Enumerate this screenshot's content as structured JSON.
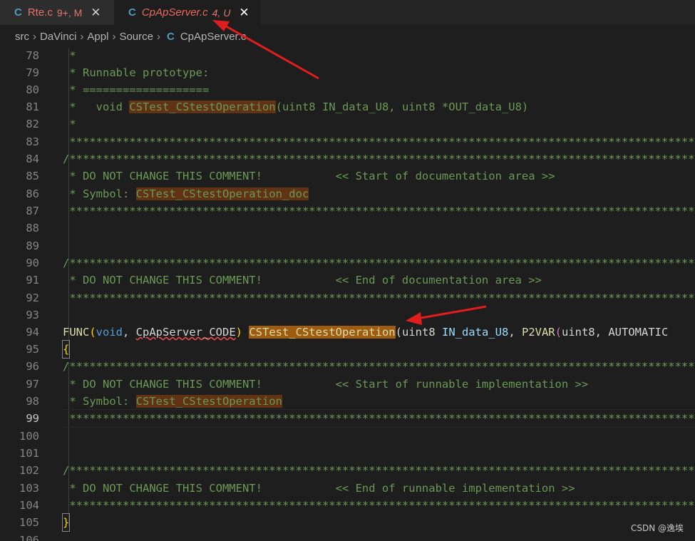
{
  "tabs": [
    {
      "icon": "C",
      "label": "Rte.c",
      "badge": "9+, M",
      "close": "✕"
    },
    {
      "icon": "C",
      "label": "CpApServer.c",
      "badge": "4, U",
      "close": "✕"
    }
  ],
  "breadcrumb": {
    "items": [
      "src",
      "DaVinci",
      "Appl",
      "Source"
    ],
    "file_icon": "C",
    "file": "CpApServer.c",
    "sep": "›"
  },
  "lines": [
    {
      "n": "78",
      "t": " *"
    },
    {
      "n": "79",
      "t": " * Runnable prototype:"
    },
    {
      "n": "80",
      "t": " * ==================="
    },
    {
      "n": "81a",
      "t": " *   void "
    },
    {
      "n": "81b",
      "t": "CSTest_CStestOperation"
    },
    {
      "n": "81c",
      "t": "(uint8 IN_data_U8, uint8 *OUT_data_U8)"
    },
    {
      "n": "82",
      "t": " *"
    },
    {
      "n": "83",
      "t": " *********************************************************************************************************"
    },
    {
      "n": "84",
      "t": "/**********************************************************************************************************"
    },
    {
      "n": "85",
      "t": " * DO NOT CHANGE THIS COMMENT!           << Start of documentation area >>"
    },
    {
      "n": "86a",
      "t": " * Symbol: "
    },
    {
      "n": "86b",
      "t": "CSTest_CStestOperation"
    },
    {
      "n": "86c",
      "t": "_doc"
    },
    {
      "n": "87",
      "t": " *********************************************************************************************************"
    },
    {
      "n": "90",
      "t": "/**********************************************************************************************************"
    },
    {
      "n": "91",
      "t": " * DO NOT CHANGE THIS COMMENT!           << End of documentation area >>"
    },
    {
      "n": "92",
      "t": " *********************************************************************************************************"
    },
    {
      "n": "94a",
      "t": "FUNC"
    },
    {
      "n": "94b",
      "t": "("
    },
    {
      "n": "94c",
      "t": "void"
    },
    {
      "n": "94d",
      "t": ", "
    },
    {
      "n": "94e",
      "t": "CpApServer_CODE"
    },
    {
      "n": "94f",
      "t": ")"
    },
    {
      "n": "94g",
      "t": " "
    },
    {
      "n": "94h",
      "t": "CSTest_CStestOperation"
    },
    {
      "n": "94i",
      "t": "(uint8 "
    },
    {
      "n": "94j",
      "t": "IN_data_U8"
    },
    {
      "n": "94k",
      "t": ", "
    },
    {
      "n": "94l",
      "t": "P2VAR"
    },
    {
      "n": "94m",
      "t": "("
    },
    {
      "n": "94n",
      "t": "uint8, AUTOMATIC"
    },
    {
      "n": "95",
      "t": "{"
    },
    {
      "n": "96",
      "t": "/**********************************************************************************************************"
    },
    {
      "n": "97",
      "t": " * DO NOT CHANGE THIS COMMENT!           << Start of runnable implementation >>"
    },
    {
      "n": "98a",
      "t": " * Symbol: "
    },
    {
      "n": "98b",
      "t": "CSTest_CStestOperation"
    },
    {
      "n": "99",
      "t": " *********************************************************************************************************"
    },
    {
      "n": "102",
      "t": "/**********************************************************************************************************"
    },
    {
      "n": "103",
      "t": " * DO NOT CHANGE THIS COMMENT!           << End of runnable implementation >>"
    },
    {
      "n": "104",
      "t": " *********************************************************************************************************"
    },
    {
      "n": "105",
      "t": "}"
    }
  ],
  "line_numbers": [
    "78",
    "79",
    "80",
    "81",
    "82",
    "83",
    "84",
    "85",
    "86",
    "87",
    "88",
    "89",
    "90",
    "91",
    "92",
    "93",
    "94",
    "95",
    "96",
    "97",
    "98",
    "99",
    "100",
    "101",
    "102",
    "103",
    "104",
    "105",
    "106"
  ],
  "watermark": "CSDN @逸埃",
  "colors": {
    "comment": "#6a9955",
    "highlight": "#613214",
    "arrow": "#e01e1e",
    "tab_label": "#e2766b"
  }
}
